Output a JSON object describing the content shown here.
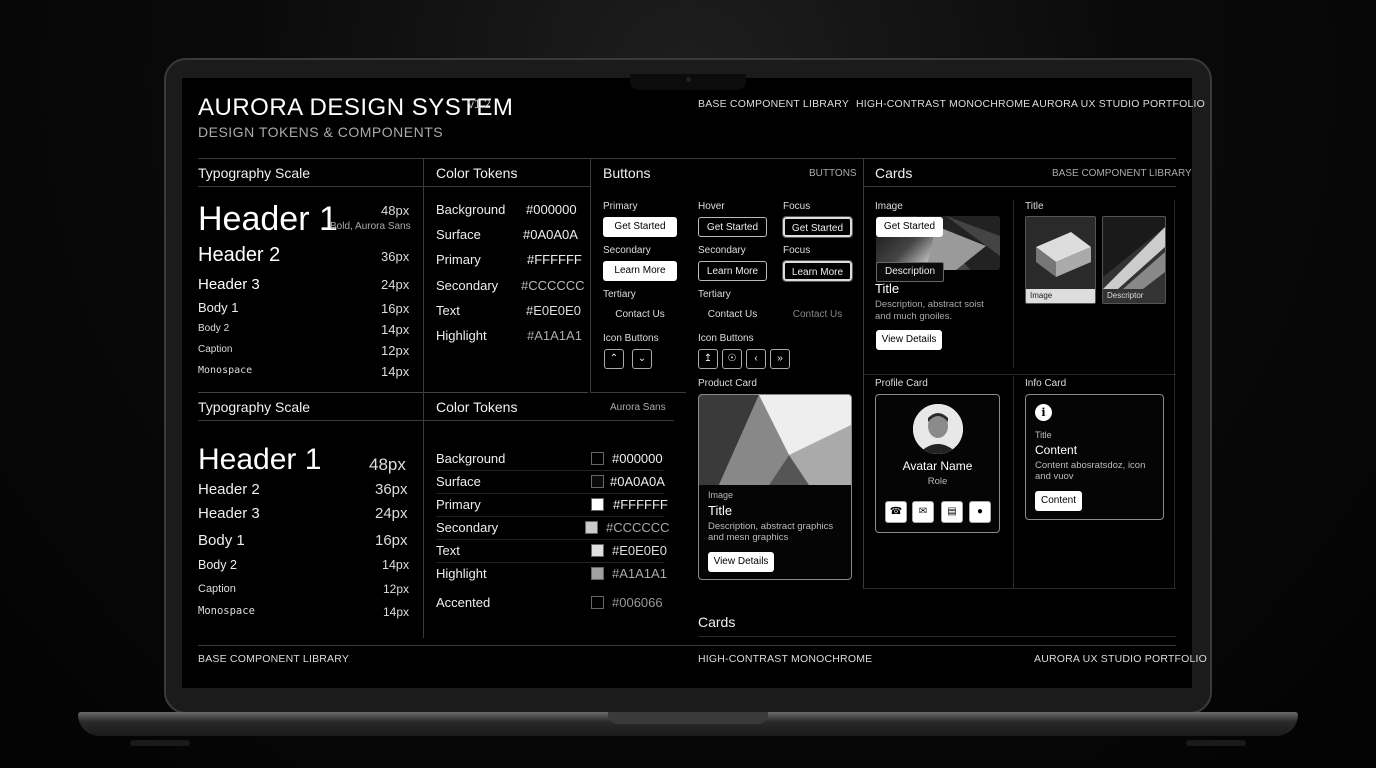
{
  "header": {
    "title": "AURORA DESIGN SYSTEM",
    "version": "v1.2",
    "subtitle": "DESIGN TOKENS & COMPONENTS",
    "nav": [
      "BASE COMPONENT LIBRARY",
      "HIGH-CONTRAST MONOCHROME",
      "AURORA UX STUDIO PORTFOLIO"
    ]
  },
  "typo1": {
    "title": "Typography Scale",
    "h1": {
      "label": "Header 1",
      "size": "48px",
      "note": "Bold, Aurora Sans"
    },
    "rows": [
      {
        "label": "Header 2",
        "size": "36px"
      },
      {
        "label": "Header 3",
        "size": "24px"
      },
      {
        "label": "Body 1",
        "size": "16px"
      },
      {
        "label": "Body 2",
        "size": "14px"
      },
      {
        "label": "Caption",
        "size": "12px"
      },
      {
        "label": "Monospace",
        "size": "14px"
      }
    ]
  },
  "colors1": {
    "title": "Color Tokens",
    "rows": [
      {
        "label": "Background",
        "value": "#000000"
      },
      {
        "label": "Surface",
        "value": "#0A0A0A"
      },
      {
        "label": "Primary",
        "value": "#FFFFFF"
      },
      {
        "label": "Secondary",
        "value": "#CCCCCC"
      },
      {
        "label": "Text",
        "value": "#E0E0E0"
      },
      {
        "label": "Highlight",
        "value": "#A1A1A1"
      }
    ]
  },
  "buttons": {
    "title": "Buttons",
    "tag": "BUTTONS",
    "primary_label": "Primary",
    "hover_label": "Hover",
    "focus_label": "Focus",
    "get_started": "Get Started",
    "secondary_label": "Secondary",
    "learn_more": "Learn More",
    "tertiary_label": "Tertiary",
    "contact_us": "Contact Us",
    "icon_buttons_label": "Icon Buttons"
  },
  "cards": {
    "title": "Cards",
    "tag": "BASE COMPONENT LIBRARY",
    "image_card": {
      "label": "Image",
      "button": "Get Started",
      "overlay": "Description",
      "title": "Title",
      "desc": "Description, abstract soist and much gnoiles.",
      "action": "View Details"
    },
    "title_card": {
      "label": "Title",
      "img1_caption": "Image",
      "img2_caption": "Descriptor"
    },
    "product_card": {
      "label": "Product Card",
      "image_label": "Image",
      "title": "Title",
      "desc": "Description, abstract graphics and mesn graphics",
      "action": "View Details"
    },
    "profile_card": {
      "label": "Profile Card",
      "name": "Avatar Name",
      "role": "Role"
    },
    "info_card": {
      "label": "Info Card",
      "small_title": "Title",
      "heading": "Content",
      "desc": "Content abosratsdoz, icon and vuov",
      "button": "Content"
    },
    "footer_heading": "Cards"
  },
  "typo2": {
    "title": "Typography Scale",
    "rows": [
      {
        "label": "Header 1",
        "size": "48px"
      },
      {
        "label": "Header 2",
        "size": "36px"
      },
      {
        "label": "Header 3",
        "size": "24px"
      },
      {
        "label": "Body 1",
        "size": "16px"
      },
      {
        "label": "Body 2",
        "size": "14px"
      },
      {
        "label": "Caption",
        "size": "12px"
      },
      {
        "label": "Monospace",
        "size": "14px"
      }
    ]
  },
  "colors2": {
    "title": "Color Tokens",
    "tag": "Aurora Sans",
    "rows": [
      {
        "label": "Background",
        "value": "#000000",
        "swatch": "#000000"
      },
      {
        "label": "Surface",
        "value": "#0A0A0A",
        "swatch": "#0A0A0A"
      },
      {
        "label": "Primary",
        "value": "#FFFFFF",
        "swatch": "#FFFFFF"
      },
      {
        "label": "Secondary",
        "value": "#CCCCCC",
        "swatch": "#CCCCCC"
      },
      {
        "label": "Text",
        "value": "#E0E0E0",
        "swatch": "#E0E0E0"
      },
      {
        "label": "Highlight",
        "value": "#A1A1A1",
        "swatch": "#A1A1A1"
      },
      {
        "label": "Accented",
        "value": "#006066",
        "swatch": "#000000"
      }
    ]
  },
  "footer": {
    "left": "BASE COMPONENT LIBRARY",
    "center": "HIGH-CONTRAST MONOCHROME",
    "right": "AURORA UX STUDIO PORTFOLIO"
  }
}
